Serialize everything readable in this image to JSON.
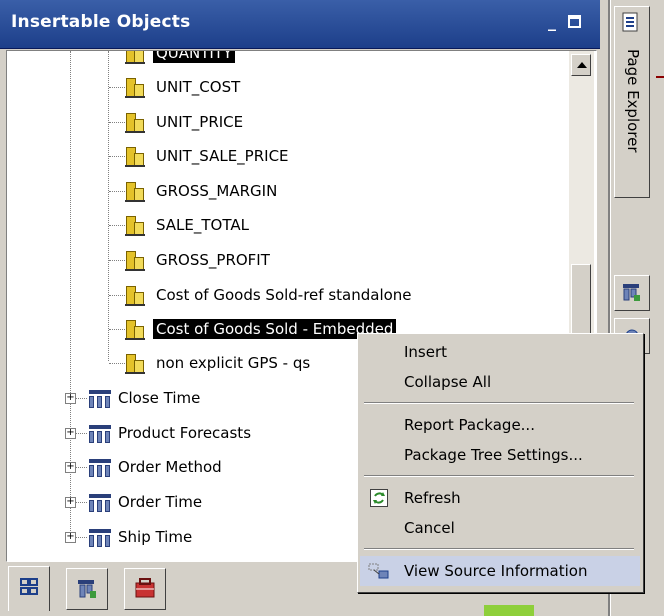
{
  "panel": {
    "title": "Insertable Objects",
    "minimize_glyph": "_"
  },
  "tree": {
    "measures": [
      {
        "label": "QUANTITY",
        "selected": true
      },
      {
        "label": "UNIT_COST"
      },
      {
        "label": "UNIT_PRICE"
      },
      {
        "label": "UNIT_SALE_PRICE"
      },
      {
        "label": "GROSS_MARGIN"
      },
      {
        "label": "SALE_TOTAL"
      },
      {
        "label": "GROSS_PROFIT"
      },
      {
        "label": "Cost of Goods Sold-ref standalone"
      },
      {
        "label": "Cost of Goods Sold - Embedded",
        "selected": true
      },
      {
        "label": "non explicit GPS - qs"
      }
    ],
    "dimensions": [
      {
        "label": "Close Time"
      },
      {
        "label": "Product Forecasts"
      },
      {
        "label": "Order Method"
      },
      {
        "label": "Order Time"
      },
      {
        "label": "Ship Time"
      }
    ]
  },
  "bottom_tabs": [
    {
      "icon": "source-tree-icon"
    },
    {
      "icon": "data-items-icon"
    },
    {
      "icon": "toolbox-icon"
    }
  ],
  "side_panel": {
    "page_explorer_label": "Page Explorer"
  },
  "context_menu": {
    "items": [
      {
        "label": "Insert"
      },
      {
        "label": "Collapse All"
      },
      {
        "label": "Report Package..."
      },
      {
        "label": "Package Tree Settings..."
      },
      {
        "label": "Refresh",
        "icon": "refresh-icon"
      },
      {
        "label": "Cancel"
      },
      {
        "label": "View Source Information",
        "icon": "source-info-icon",
        "hover": true
      }
    ]
  },
  "colors": {
    "title_bar": "#1d3f8a",
    "selection": "#000000",
    "menu_hover": "#c9d1e6"
  }
}
